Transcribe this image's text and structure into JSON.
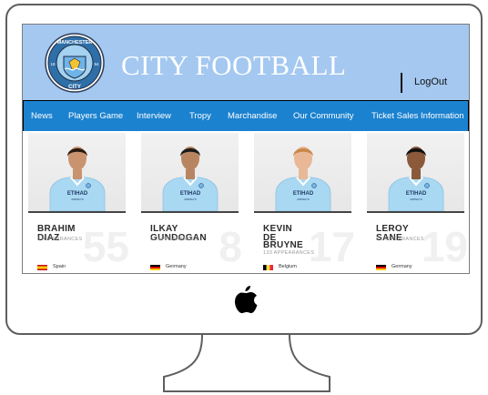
{
  "brand": {
    "title": "CITY FOOTBALL",
    "crest_top": "MANCHESTER",
    "crest_bottom": "CITY",
    "crest_left": "18",
    "crest_right": "94"
  },
  "header": {
    "logout_label": "LogOut"
  },
  "nav": {
    "items": [
      {
        "label": "News",
        "active": false
      },
      {
        "label": "Players Game",
        "active": true
      },
      {
        "label": "Interview",
        "active": false
      },
      {
        "label": "Tropy",
        "active": false
      },
      {
        "label": "Marchandise",
        "active": false
      },
      {
        "label": "Our Community",
        "active": false
      },
      {
        "label": "Ticket Sales Information",
        "active": false
      }
    ]
  },
  "players": [
    {
      "first": "BRAHIM",
      "last": "DIAZ",
      "last2": "",
      "apps": "8 APPEARANCES",
      "number": "55",
      "country": "Spain",
      "flag": "spain"
    },
    {
      "first": "ILKAY",
      "last": "GUNDOGAN",
      "last2": "",
      "apps": "62 APPEARANCES",
      "number": "8",
      "country": "Germany",
      "flag": "germany"
    },
    {
      "first": "KEVIN",
      "last": "DE",
      "last2": "BRUYNE",
      "apps": "133 APPEARANCES",
      "number": "17",
      "country": "Belgium",
      "flag": "belgium"
    },
    {
      "first": "LEROY",
      "last": "SANE",
      "last2": "",
      "apps": "66 APPEARANCES",
      "number": "19",
      "country": "Germany",
      "flag": "germany"
    }
  ],
  "kit": {
    "sponsor": "ETIHAD",
    "sponsor_sub": "AIRWAYS"
  },
  "colors": {
    "header_bg": "#a4c8f0",
    "nav_bg": "#1b82cf",
    "kit_blue": "#a9d8f2"
  },
  "device": {
    "logo_icon": "apple-logo-icon"
  }
}
